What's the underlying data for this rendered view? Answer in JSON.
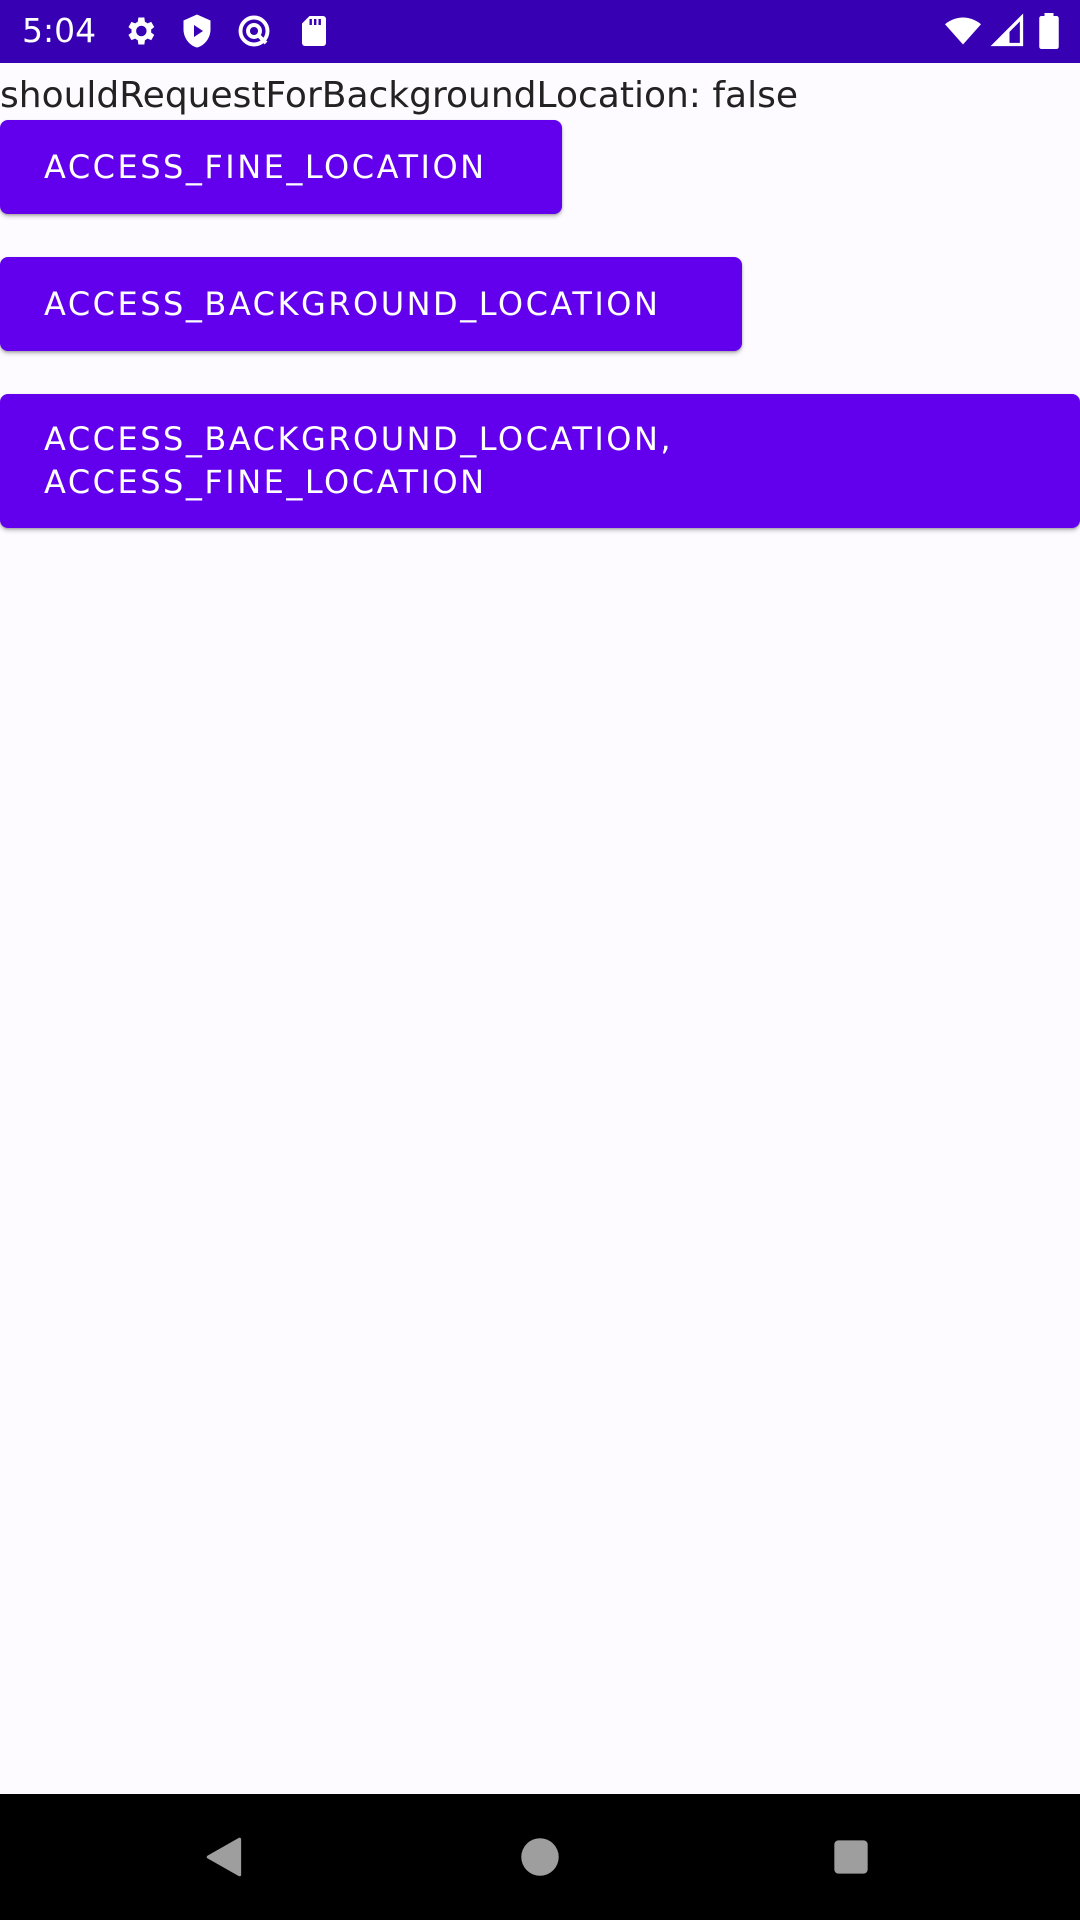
{
  "status_bar": {
    "time": "5:04",
    "background_color": "#3700b3",
    "left_icons": [
      "settings-icon",
      "shield-play-icon",
      "vpn-icon",
      "sd-card-icon"
    ],
    "right_icons": [
      "wifi-icon",
      "cellular-signal-icon",
      "battery-icon"
    ]
  },
  "main": {
    "status_text": "shouldRequestForBackgroundLocation: false",
    "buttons": [
      {
        "label": "ACCESS_FINE_LOCATION"
      },
      {
        "label": "ACCESS_BACKGROUND_LOCATION"
      },
      {
        "label": "ACCESS_BACKGROUND_LOCATION,\nACCESS_FINE_LOCATION"
      }
    ],
    "button_color": "#6200ee"
  },
  "nav_bar": {
    "icons": [
      "back-icon",
      "home-icon",
      "recents-icon"
    ],
    "icon_color": "#9e9e9e"
  }
}
